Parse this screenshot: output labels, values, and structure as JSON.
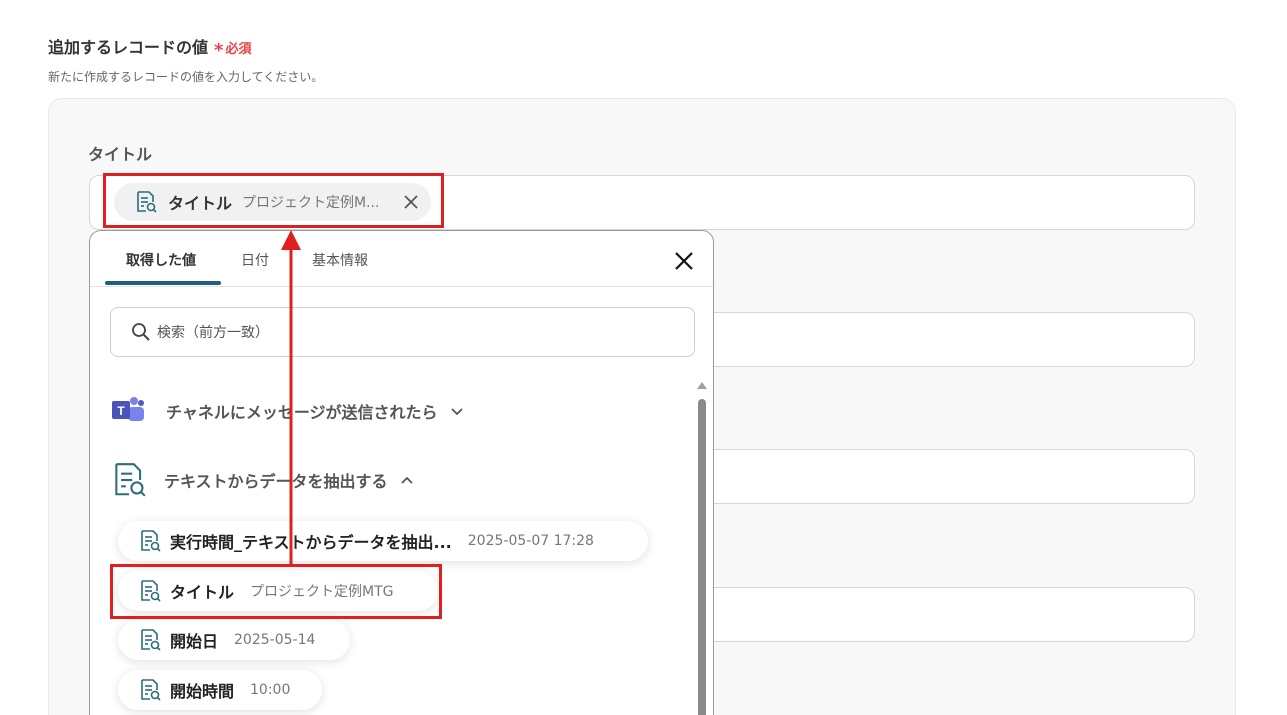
{
  "section": {
    "title": "追加するレコードの値",
    "required_star": "*",
    "required_label": "必須",
    "description": "新たに作成するレコードの値を入力してください。"
  },
  "field": {
    "label": "タイトル",
    "pill_name": "タイトル",
    "pill_value": "プロジェクト定例M..."
  },
  "dropdown": {
    "tabs": [
      "取得した値",
      "日付",
      "基本情報"
    ],
    "search_placeholder": "検索（前方一致）",
    "groups": [
      {
        "label": "チャネルにメッセージが送信されたら",
        "icon": "teams-icon",
        "expanded": false
      },
      {
        "label": "テキストからデータを抽出する",
        "icon": "doc-search-icon",
        "expanded": true
      }
    ],
    "items": [
      {
        "name": "実行時間_テキストからデータを抽出...",
        "value": "2025-05-07 17:28"
      },
      {
        "name": "タイトル",
        "value": "プロジェクト定例MTG"
      },
      {
        "name": "開始日",
        "value": "2025-05-14"
      },
      {
        "name": "開始時間",
        "value": "10:00"
      }
    ]
  },
  "colors": {
    "highlight": "#e02020",
    "required": "#e8424a",
    "tab_underline": "#1e5f86",
    "icon_teal": "#2a6e7a"
  }
}
